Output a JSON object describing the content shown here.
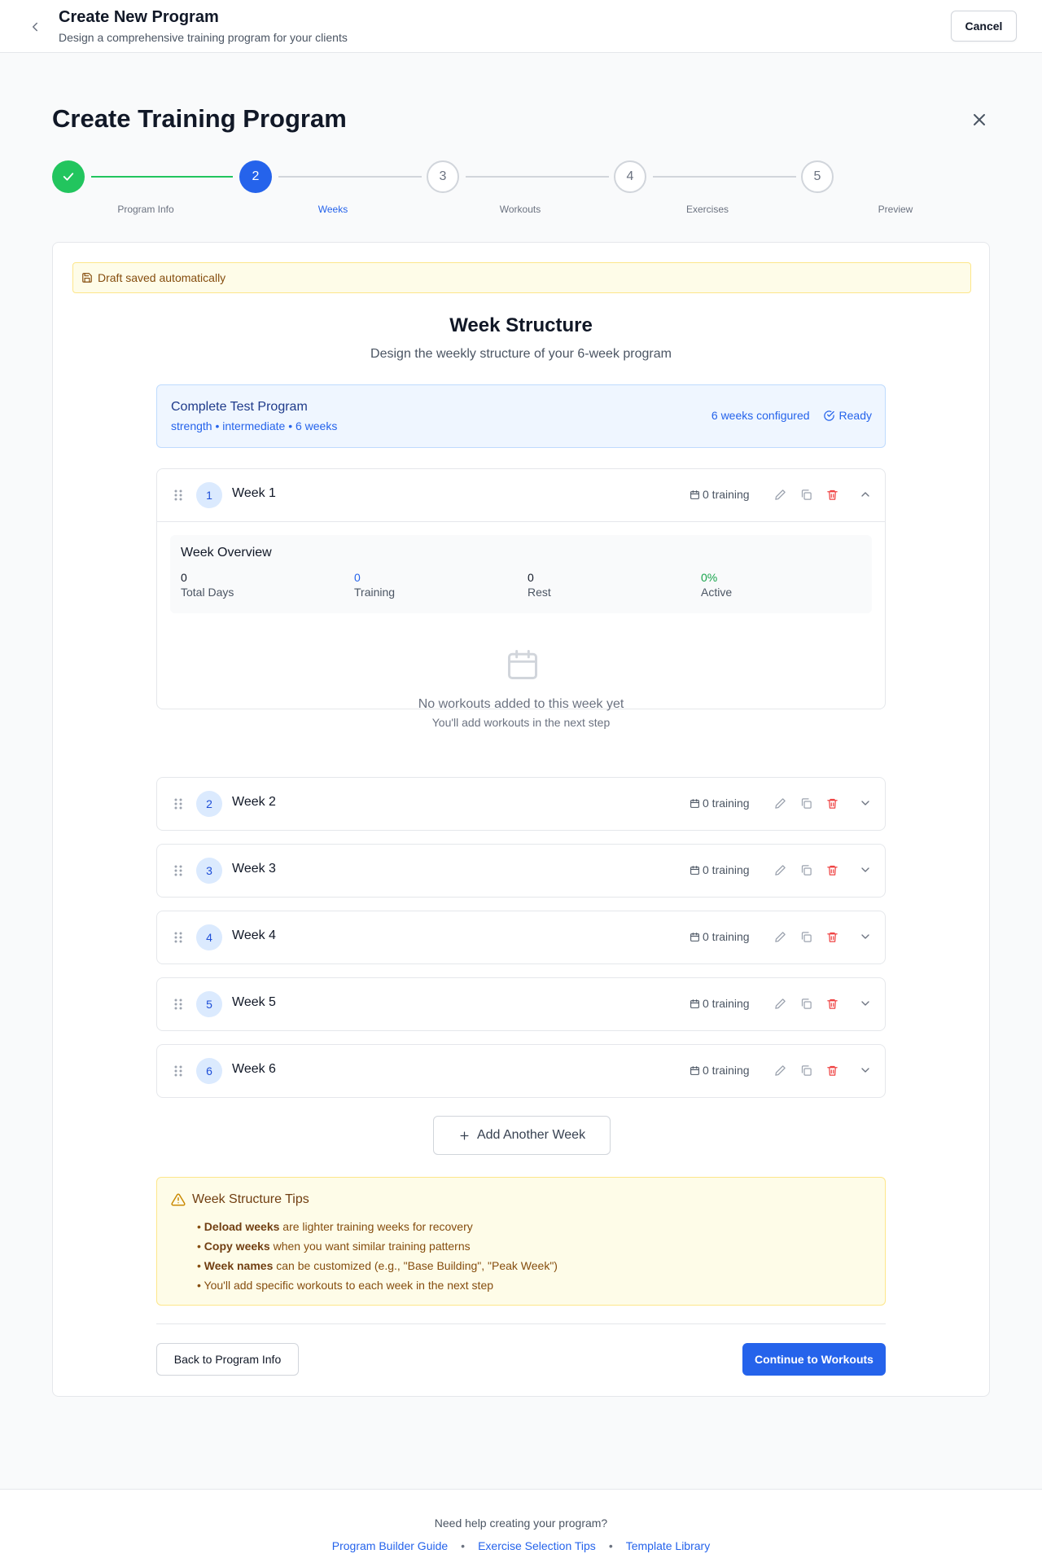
{
  "header": {
    "title": "Create New Program",
    "subtitle": "Design a comprehensive training program for your clients",
    "cancel_label": "Cancel"
  },
  "page_title": "Create Training Program",
  "stepper": [
    {
      "number": "1",
      "label": "Program Info",
      "state": "completed"
    },
    {
      "number": "2",
      "label": "Weeks",
      "state": "active"
    },
    {
      "number": "3",
      "label": "Workouts",
      "state": "upcoming"
    },
    {
      "number": "4",
      "label": "Exercises",
      "state": "upcoming"
    },
    {
      "number": "5",
      "label": "Preview",
      "state": "upcoming"
    }
  ],
  "draft_notice": "Draft saved automatically",
  "section": {
    "title": "Week Structure",
    "subtitle": "Design the weekly structure of your 6-week program"
  },
  "program_summary": {
    "name": "Complete Test Program",
    "meta": "strength • intermediate • 6 weeks",
    "configured": "6 weeks configured",
    "status": "Ready"
  },
  "weeks": [
    {
      "number": "1",
      "name": "Week 1",
      "training": "0 training",
      "expanded": true
    },
    {
      "number": "2",
      "name": "Week 2",
      "training": "0 training",
      "expanded": false
    },
    {
      "number": "3",
      "name": "Week 3",
      "training": "0 training",
      "expanded": false
    },
    {
      "number": "4",
      "name": "Week 4",
      "training": "0 training",
      "expanded": false
    },
    {
      "number": "5",
      "name": "Week 5",
      "training": "0 training",
      "expanded": false
    },
    {
      "number": "6",
      "name": "Week 6",
      "training": "0 training",
      "expanded": false
    }
  ],
  "week_overview": {
    "title": "Week Overview",
    "stats": [
      {
        "value": "0",
        "label": "Total Days"
      },
      {
        "value": "0",
        "label": "Training"
      },
      {
        "value": "0",
        "label": "Rest"
      },
      {
        "value": "0%",
        "label": "Active"
      }
    ],
    "empty_title": "No workouts added to this week yet",
    "empty_subtitle": "You'll add workouts in the next step"
  },
  "add_week_label": "Add Another Week",
  "tips": {
    "title": "Week Structure Tips",
    "items": [
      {
        "bold": "Deload weeks",
        "text": " are lighter training weeks for recovery"
      },
      {
        "bold": "Copy weeks",
        "text": " when you want similar training patterns"
      },
      {
        "bold": "Week names",
        "text": " can be customized (e.g., \"Base Building\", \"Peak Week\")"
      },
      {
        "bold": "",
        "text": "You'll add specific workouts to each week in the next step"
      }
    ]
  },
  "nav": {
    "back_label": "Back to Program Info",
    "continue_label": "Continue to Workouts"
  },
  "footer": {
    "question": "Need help creating your program?",
    "links": [
      "Program Builder Guide",
      "Exercise Selection Tips",
      "Template Library"
    ]
  },
  "colors": {
    "primary": "#2563eb",
    "success": "#22c55e",
    "danger": "#ef4444",
    "warning_bg": "#fefce8"
  },
  "icons": {
    "back": "chevron-left-icon",
    "close": "close-icon",
    "check": "check-icon",
    "save": "save-icon",
    "ready": "check-circle-icon",
    "drag": "drag-handle-icon",
    "calendar": "calendar-icon",
    "edit": "pencil-icon",
    "copy": "copy-icon",
    "delete": "trash-icon",
    "collapse": "chevron-up-icon",
    "expand": "chevron-down-icon",
    "add": "plus-icon",
    "warning": "warning-triangle-icon"
  }
}
